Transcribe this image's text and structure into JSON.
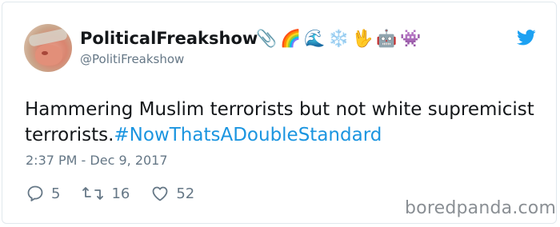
{
  "tweet": {
    "author_name": "PoliticalFreakshow",
    "name_emojis": [
      "📎",
      "🌈",
      "🌊",
      "❄️",
      "🖖",
      "🤖",
      "👾"
    ],
    "handle": "@PolitiFreakshow",
    "text_plain": "Hammering Muslim terrorists but not white supremicist terrorists.",
    "hashtag": "#NowThatsADoubleStandard",
    "timestamp": "2:37 PM - Dec 9, 2017",
    "replies": "5",
    "retweets": "16",
    "likes": "52"
  },
  "colors": {
    "hashtag": "#1b95e0",
    "twitter_blue": "#1da1f2",
    "secondary_text": "#657786"
  },
  "icons": {
    "brand": "twitter-bird-icon",
    "reply": "reply-icon",
    "retweet": "retweet-icon",
    "like": "heart-icon"
  },
  "watermark": "boredpanda.com"
}
